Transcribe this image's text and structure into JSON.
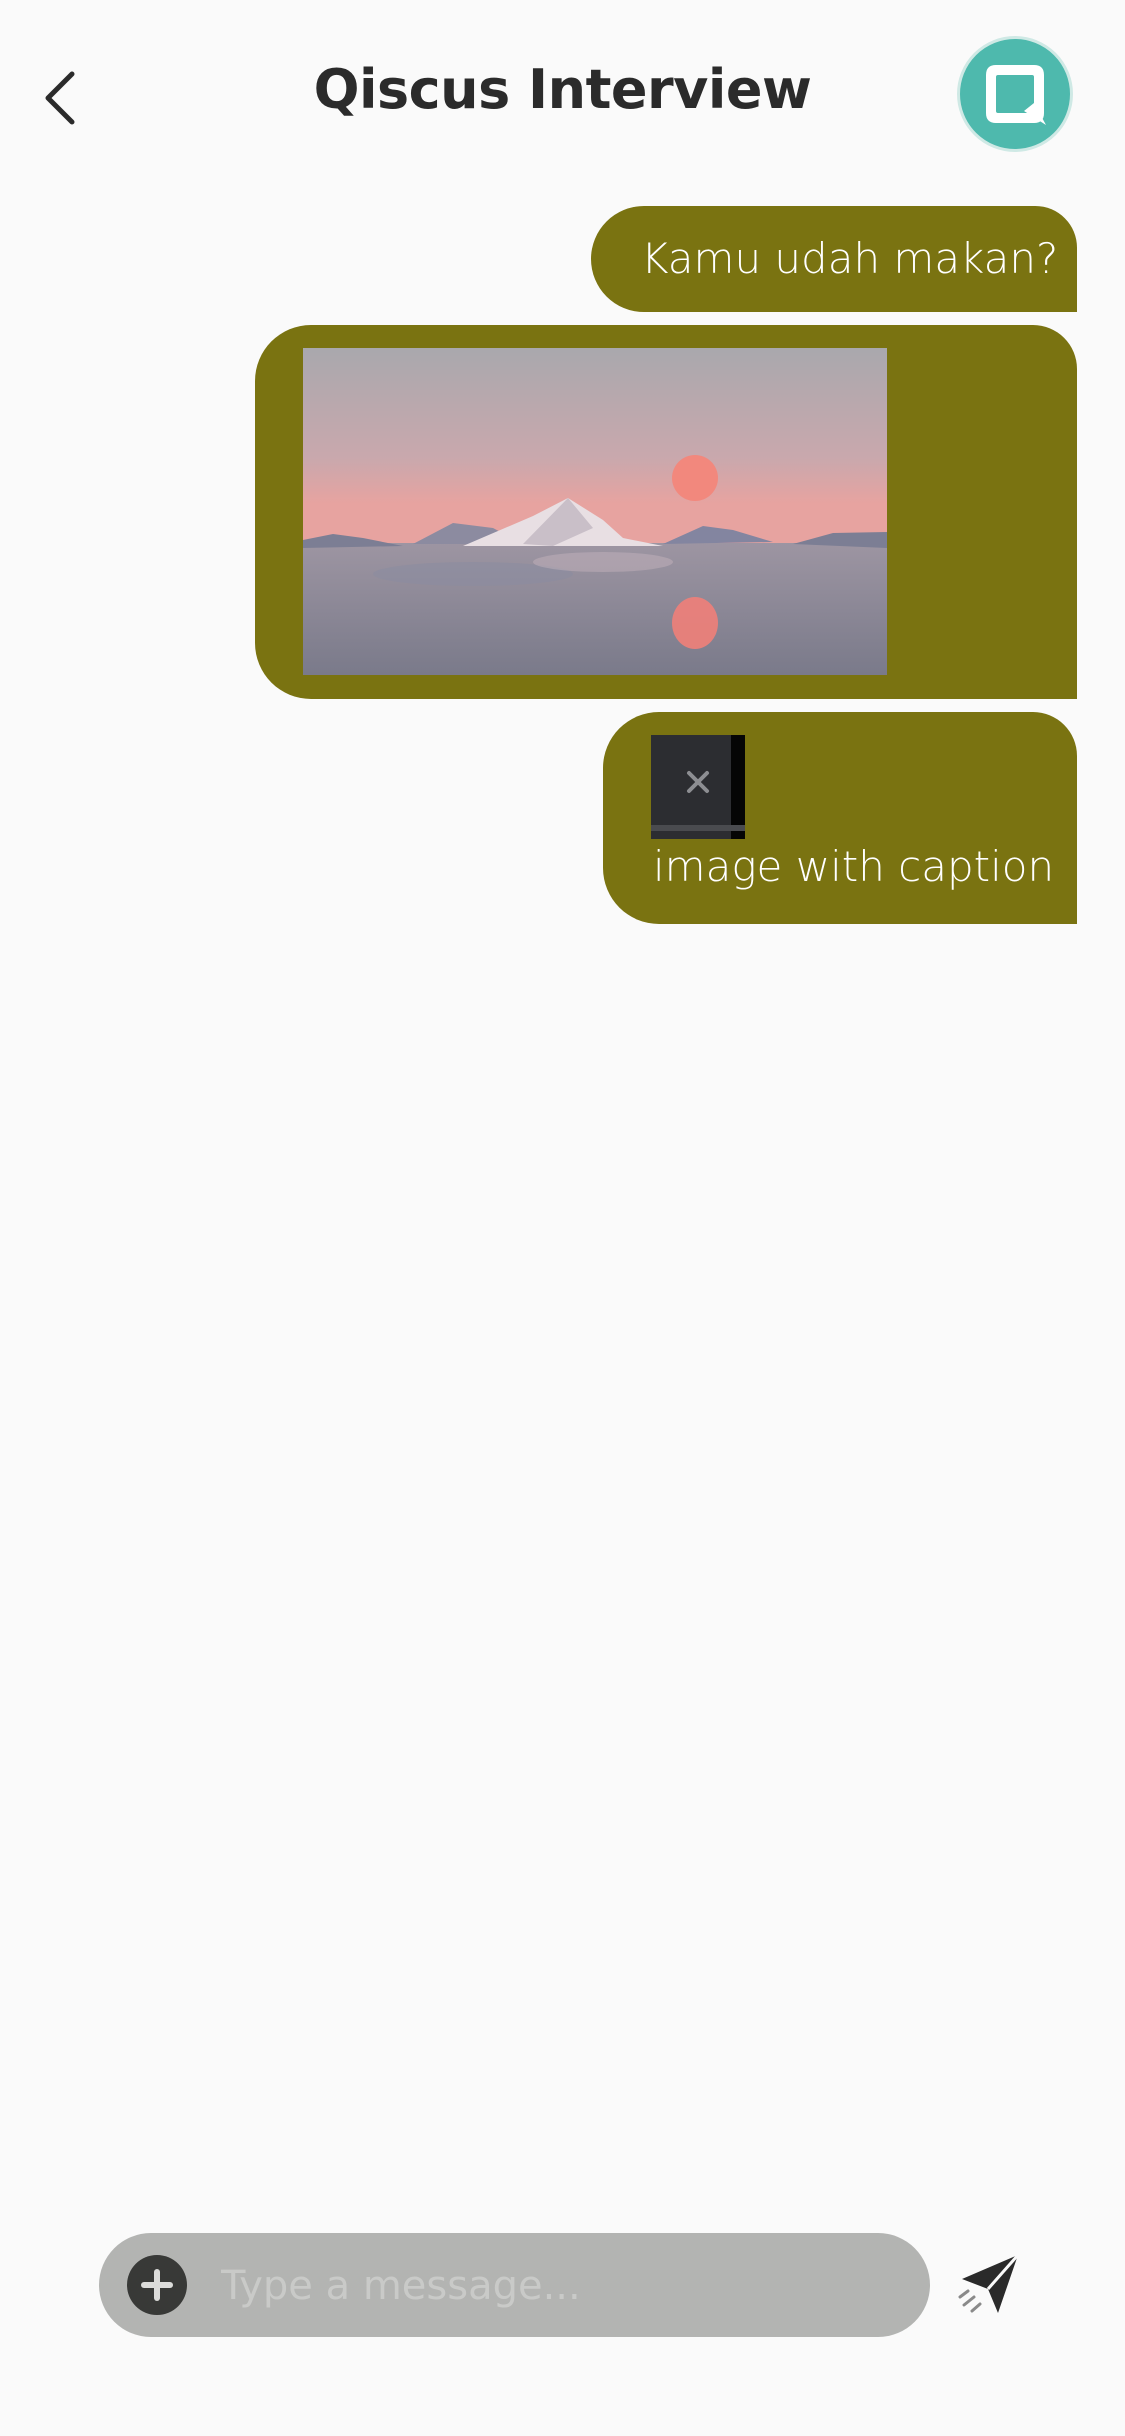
{
  "header": {
    "title": "Qiscus Interview",
    "back_icon": "chevron-left-icon",
    "avatar_icon": "qiscus-logo-icon"
  },
  "messages": [
    {
      "type": "text",
      "text": "Kamu udah makan?"
    },
    {
      "type": "image",
      "image": "sunset-landscape-image"
    },
    {
      "type": "image_caption",
      "image": "broken-image-icon",
      "caption": "image with caption"
    }
  ],
  "composer": {
    "placeholder": "Type a message...",
    "attach_icon": "plus-circle-icon",
    "send_icon": "send-paper-plane-icon"
  },
  "colors": {
    "bubble": "#7a7311",
    "avatar": "#4eb9ad",
    "input_bg": "#b3b4b2",
    "background": "#fafafa"
  }
}
